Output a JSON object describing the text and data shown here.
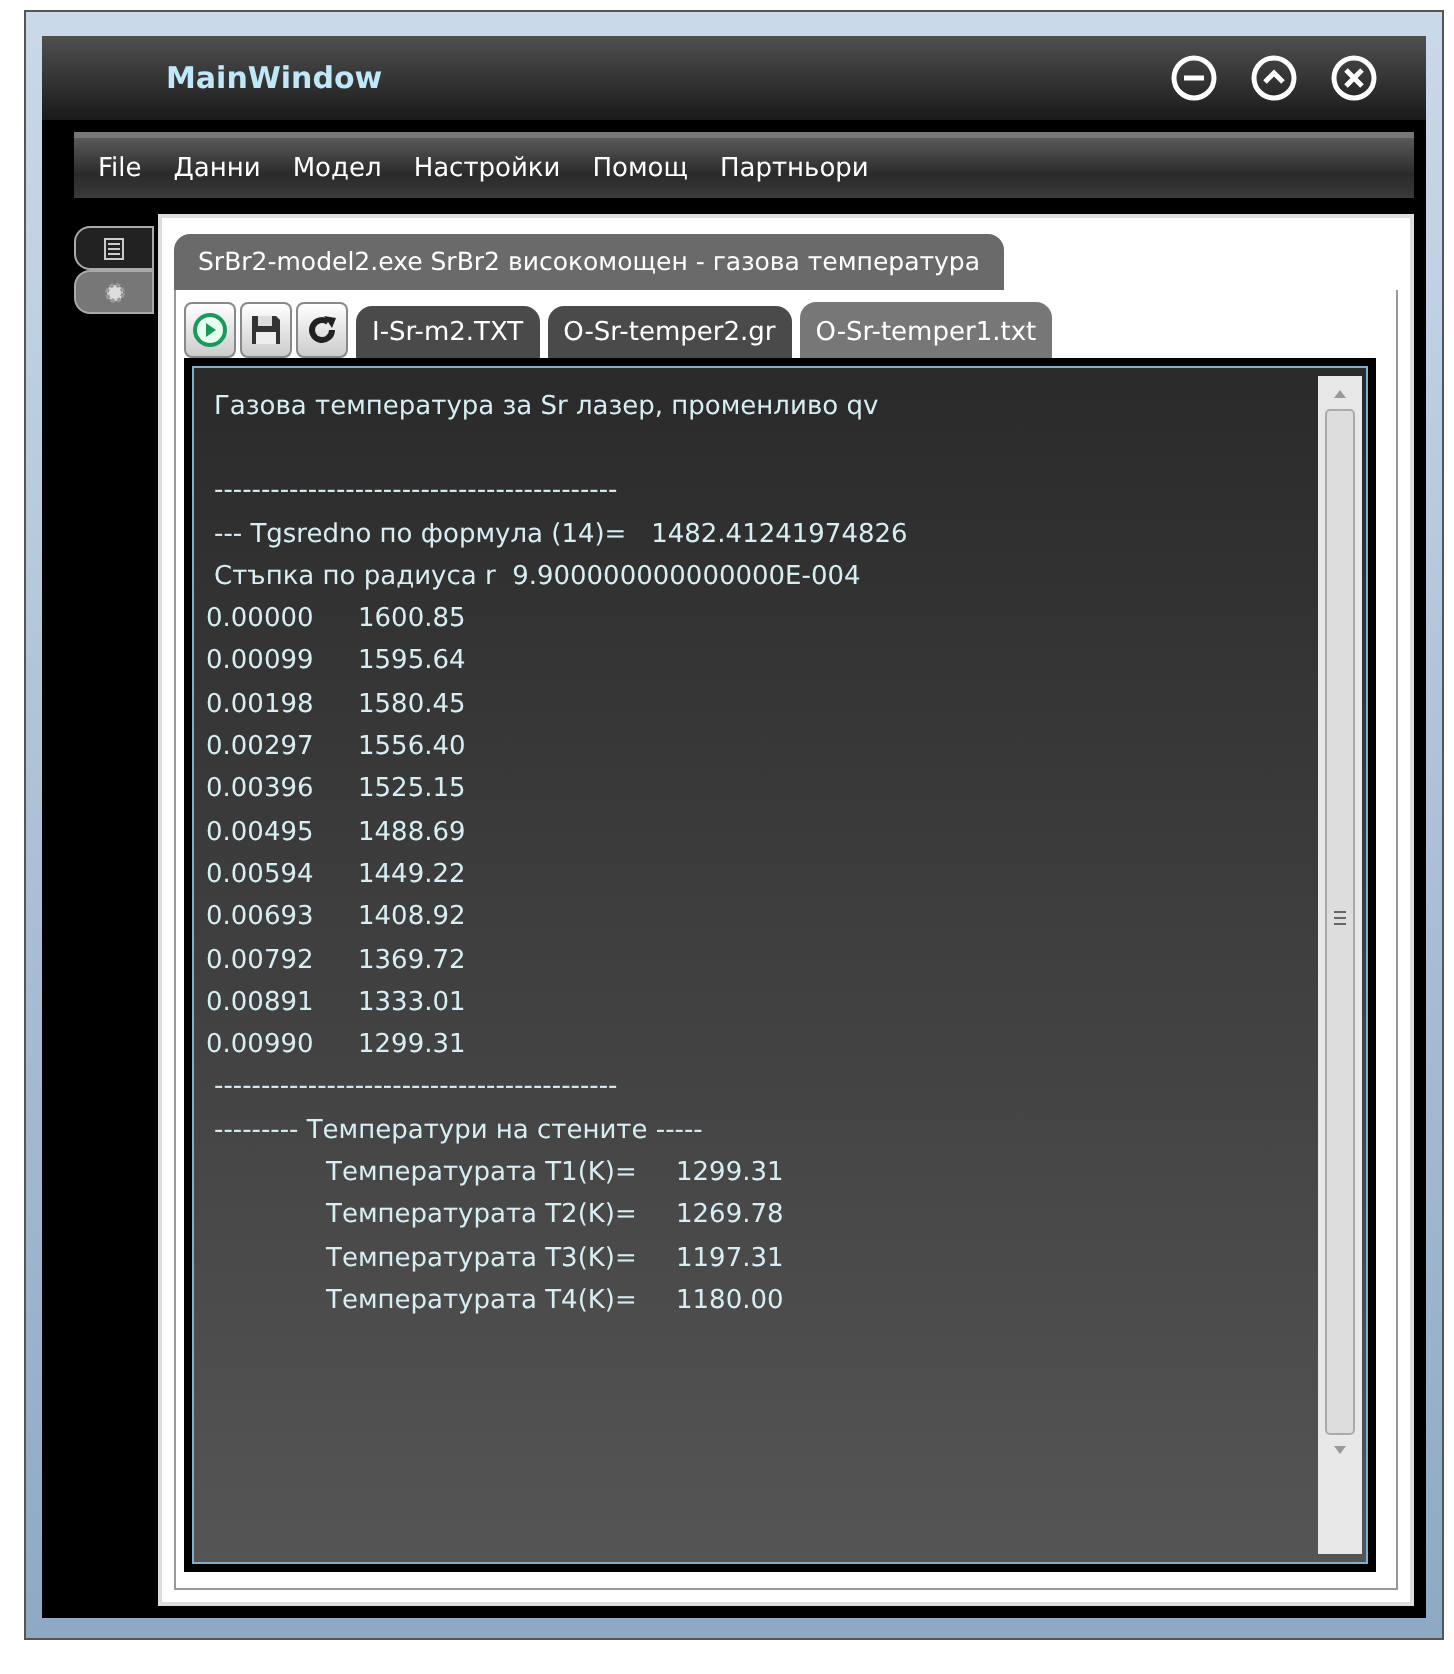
{
  "window": {
    "title": "MainWindow"
  },
  "menu": [
    "File",
    "Данни",
    "Модел",
    "Настройки",
    "Помощ",
    "Партньори"
  ],
  "side_tabs": [
    {
      "kind": "list",
      "selected": true
    },
    {
      "kind": "gear",
      "selected": false
    }
  ],
  "document_tab": {
    "label": "SrBr2-model2.exe SrBr2  високомощен - газова температура",
    "selected": true
  },
  "toolbar": [
    {
      "kind": "run"
    },
    {
      "kind": "save"
    },
    {
      "kind": "refresh"
    }
  ],
  "file_tabs": [
    {
      "label": "I-Sr-m2.TXT",
      "selected": false
    },
    {
      "label": "O-Sr-temper2.gr",
      "selected": false
    },
    {
      "label": "O-Sr-temper1.txt",
      "selected": true
    }
  ],
  "output": [
    {
      "kind": "title",
      "text": "Газова температура за Sr лазер, променливо qv"
    },
    {
      "kind": "text",
      "text": "-------------------------------------------"
    },
    {
      "kind": "text",
      "text": "--- Tgsredno по формула (14)=   1482.41241974826"
    },
    {
      "kind": "text",
      "text": "Стъпка по радиуса r  9.900000000000000E-004"
    },
    {
      "kind": "row",
      "cells": [
        "0.00000",
        "1600.85"
      ]
    },
    {
      "kind": "row",
      "cells": [
        "0.00099",
        "1595.64"
      ]
    },
    {
      "kind": "row",
      "cells": [
        "0.00198",
        "1580.45"
      ]
    },
    {
      "kind": "row",
      "cells": [
        "0.00297",
        "1556.40"
      ]
    },
    {
      "kind": "row",
      "cells": [
        "0.00396",
        "1525.15"
      ]
    },
    {
      "kind": "row",
      "cells": [
        "0.00495",
        "1488.69"
      ]
    },
    {
      "kind": "row",
      "cells": [
        "0.00594",
        "1449.22"
      ]
    },
    {
      "kind": "row",
      "cells": [
        "0.00693",
        "1408.92"
      ]
    },
    {
      "kind": "row",
      "cells": [
        "0.00792",
        "1369.72"
      ]
    },
    {
      "kind": "row",
      "cells": [
        "0.00891",
        "1333.01"
      ]
    },
    {
      "kind": "row",
      "cells": [
        "0.00990",
        "1299.31"
      ]
    },
    {
      "kind": "text",
      "text": "-------------------------------------------"
    },
    {
      "kind": "text",
      "text": "--------- Температури на стените -----"
    },
    {
      "kind": "result",
      "cells": [
        "Температурата T1(K)=",
        "1299.31"
      ]
    },
    {
      "kind": "result",
      "cells": [
        "Температурата T2(K)=",
        "1269.78"
      ]
    },
    {
      "kind": "result",
      "cells": [
        "Температурата T3(K)=",
        "1197.31"
      ]
    },
    {
      "kind": "result",
      "cells": [
        "Температурата T4(K)=",
        "1180.00"
      ]
    }
  ]
}
